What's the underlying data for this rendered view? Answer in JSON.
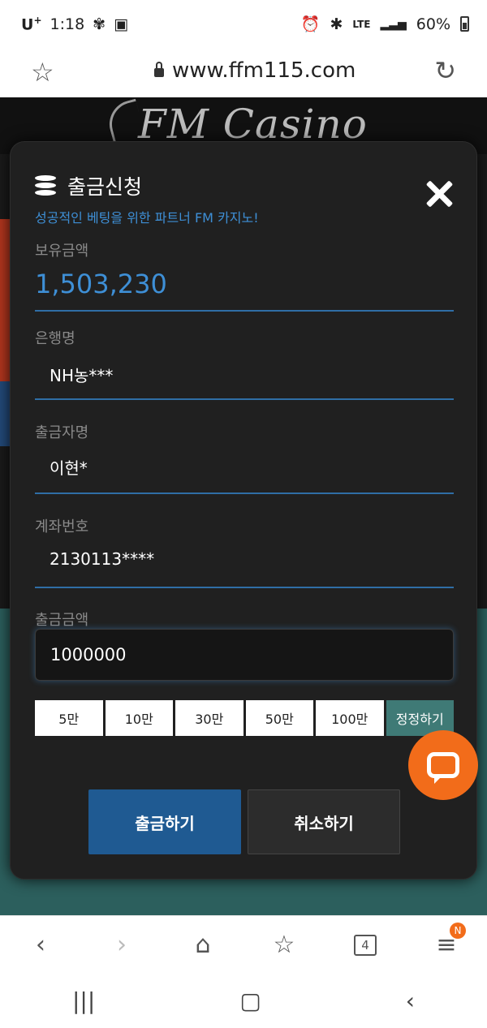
{
  "status_bar": {
    "carrier": "U",
    "carrier_sup": "+",
    "time": "1:18",
    "network": "LTE",
    "battery": "60%"
  },
  "browser": {
    "url": "www.ffm115.com",
    "tabs_count": "4",
    "menu_badge": "N"
  },
  "site": {
    "logo": "FM Casino"
  },
  "modal": {
    "title": "출금신청",
    "tagline": "성공적인 베팅을 위한 파트너 FM 카지노!",
    "balance_label": "보유금액",
    "balance_value": "1,503,230",
    "bank_label": "은행명",
    "bank_value": "NH농***",
    "holder_label": "출금자명",
    "holder_value": "이현*",
    "account_label": "계좌번호",
    "account_value": "2130113****",
    "amount_label": "출금금액",
    "amount_value": "1000000",
    "quick_amounts": [
      "5만",
      "10만",
      "30만",
      "50만",
      "100만"
    ],
    "reset_label": "정정하기",
    "submit_label": "출금하기",
    "cancel_label": "취소하기"
  },
  "colors": {
    "accent_blue": "#3e8fd6",
    "submit_blue": "#1f5a92",
    "reset_teal": "#3f7a76",
    "chat_orange": "#f26c1a"
  },
  "icons": {
    "title": "coins-icon",
    "close": "close-icon",
    "chat": "chat-icon"
  }
}
